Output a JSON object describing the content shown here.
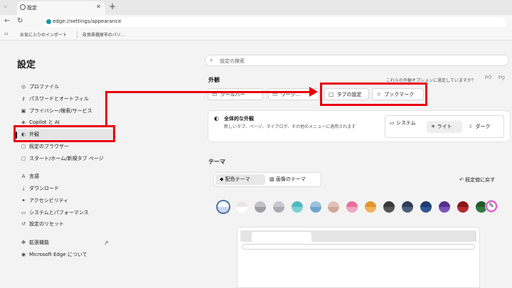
{
  "browser": {
    "tab_title": "設定",
    "tab_close": "✕",
    "new_tab": "+",
    "address": "edge://settings/appearance",
    "favorites": [
      "お気に入りのインポート",
      "奈良県橿原市のパソ..."
    ]
  },
  "sidebar": {
    "title": "設定",
    "items": [
      {
        "label": "プロファイル",
        "icon": "person-icon"
      },
      {
        "label": "パスワードとオートフィル",
        "icon": "key-icon"
      },
      {
        "label": "プライバシー/検索/サービス",
        "icon": "lock-icon"
      },
      {
        "label": "Copilot と AI",
        "icon": "copilot-icon"
      },
      {
        "label": "外観",
        "icon": "palette-icon"
      },
      {
        "label": "既定のブラウザー",
        "icon": "browser-icon"
      },
      {
        "label": "スタート/ホーム/新規タブ ページ",
        "icon": "home-icon"
      },
      {
        "label": "言語",
        "icon": "language-icon"
      },
      {
        "label": "ダウンロード",
        "icon": "download-icon"
      },
      {
        "label": "アクセシビリティ",
        "icon": "accessibility-icon"
      },
      {
        "label": "システムとパフォーマンス",
        "icon": "laptop-icon"
      },
      {
        "label": "設定のリセット",
        "icon": "reset-icon"
      },
      {
        "label": "拡張機能",
        "icon": "extensions-icon"
      },
      {
        "label": "Microsoft Edge について",
        "icon": "edge-icon"
      }
    ]
  },
  "main": {
    "search_placeholder": "設定の検索",
    "appearance_title": "外観",
    "feedback_text": "これらの外観オプションに満足していますか？",
    "toolbar_buttons": [
      "タブの設定",
      "ブックマーク"
    ],
    "hidden_buttons": [
      "ツールバー",
      "ワーク..."
    ],
    "overall": {
      "title": "全体的な外観",
      "desc": "新しいタブ、ページ、ダイアログ、その他のメニューに適用されます",
      "options": [
        "システム",
        "ライト",
        "ダーク"
      ],
      "selected": "ライト"
    },
    "theme_title": "テーマ",
    "theme_tabs": [
      "配色テーマ",
      "画像のテーマ"
    ],
    "selected_theme_tab": "配色テーマ",
    "reset_label": "既定値に戻す",
    "swatches": [
      [
        "#ffffff",
        "#c8d7f0"
      ],
      [
        "#ece7e3",
        "#ffffff"
      ],
      [
        "#bfc3c7",
        "#9aa0a6"
      ],
      [
        "#c5c8cc",
        "#a8adb3"
      ],
      [
        "#4fb8bf",
        "#7fd0d4"
      ],
      [
        "#9cc2e0",
        "#6fa3cf"
      ],
      [
        "#e3c2b8",
        "#cfa79b"
      ],
      [
        "#e8709a",
        "#f2a3bf"
      ],
      [
        "#e2962f",
        "#f0b35c"
      ],
      [
        "#3a3a3a",
        "#555555"
      ],
      [
        "#2e3e57",
        "#4a5d7c"
      ],
      [
        "#1e3c6e",
        "#2f5594"
      ],
      [
        "#55308f",
        "#7c52b8"
      ],
      [
        "#8b1418",
        "#b22a2f"
      ],
      [
        "#1f5a2b",
        "#2f7a3d"
      ]
    ]
  },
  "colors": {
    "annotation": "#e8000b",
    "accent": "#0f6cbd"
  }
}
